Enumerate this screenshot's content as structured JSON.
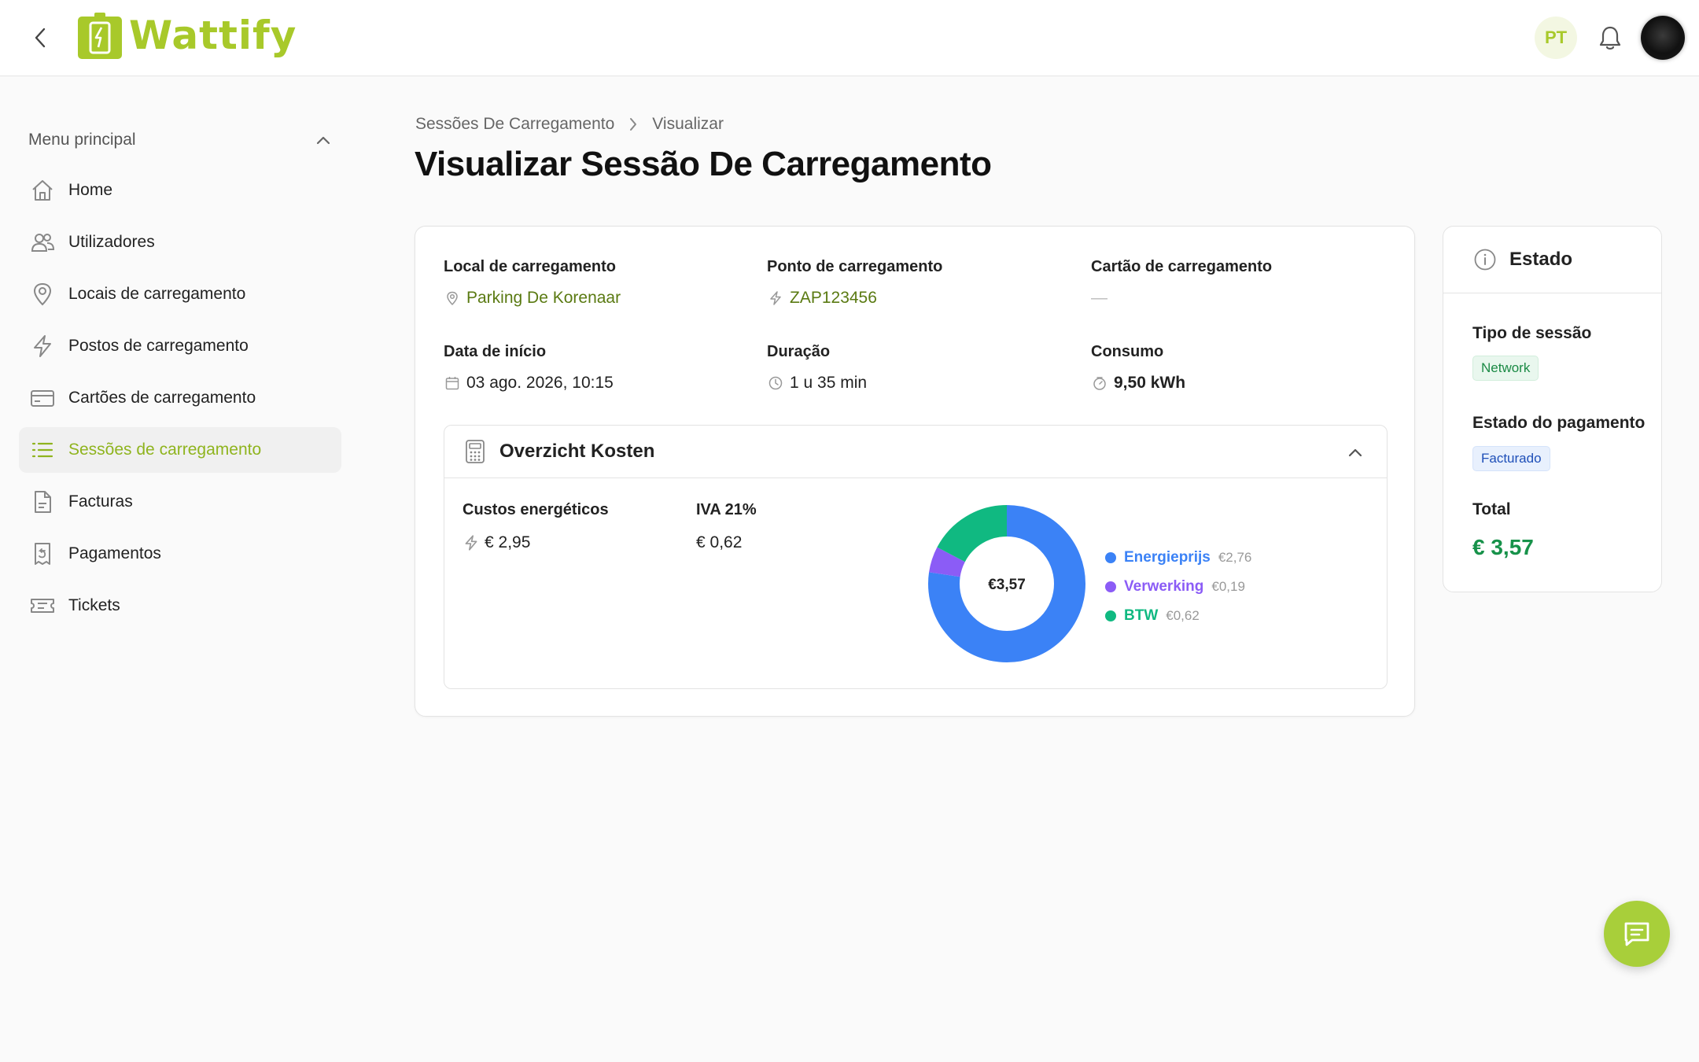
{
  "app": {
    "name": "Wattify",
    "user_initials": "PT"
  },
  "sidebar": {
    "menu_title": "Menu principal",
    "items": [
      {
        "label": "Home",
        "icon": "home-icon"
      },
      {
        "label": "Utilizadores",
        "icon": "users-icon"
      },
      {
        "label": "Locais de carregamento",
        "icon": "map-pin-icon"
      },
      {
        "label": "Postos de carregamento",
        "icon": "bolt-icon"
      },
      {
        "label": "Cartões de carregamento",
        "icon": "card-icon"
      },
      {
        "label": "Sessões de carregamento",
        "icon": "list-icon",
        "active": true
      },
      {
        "label": "Facturas",
        "icon": "document-icon"
      },
      {
        "label": "Pagamentos",
        "icon": "receipt-icon"
      },
      {
        "label": "Tickets",
        "icon": "ticket-icon"
      }
    ]
  },
  "breadcrumb": {
    "parent": "Sessões De Carregamento",
    "current": "Visualizar"
  },
  "page": {
    "title": "Visualizar Sessão De Carregamento"
  },
  "details": {
    "location": {
      "label": "Local de carregamento",
      "value": "Parking De Korenaar"
    },
    "charge_point": {
      "label": "Ponto de carregamento",
      "value": "ZAP123456"
    },
    "charge_card": {
      "label": "Cartão de carregamento",
      "value": "—"
    },
    "start_date": {
      "label": "Data de início",
      "value": "03 ago. 2026, 10:15"
    },
    "duration": {
      "label": "Duração",
      "value": "1 u 35 min"
    },
    "consumption": {
      "label": "Consumo",
      "value": "9,50 kWh"
    }
  },
  "costs": {
    "title": "Overzicht Kosten",
    "energy": {
      "label": "Custos energéticos",
      "value": "€ 2,95"
    },
    "vat": {
      "label": "IVA 21%",
      "value": "€ 0,62"
    },
    "donut_center": "€3,57",
    "breakdown": [
      {
        "name": "Energieprijs",
        "amount": "€2,76",
        "value": 2.76,
        "color": "#3b82f6"
      },
      {
        "name": "Verwerking",
        "amount": "€0,19",
        "value": 0.19,
        "color": "#8b5cf6"
      },
      {
        "name": "BTW",
        "amount": "€0,62",
        "value": 0.62,
        "color": "#10b981"
      }
    ]
  },
  "status": {
    "title": "Estado",
    "session_type": {
      "label": "Tipo de sessão",
      "value": "Network"
    },
    "payment_status": {
      "label": "Estado do pagamento",
      "value": "Facturado"
    },
    "total": {
      "label": "Total",
      "value": "€ 3,57"
    }
  },
  "colors": {
    "brand": "#a8c92a",
    "accent_active": "#8fb41e",
    "total": "#17924a"
  }
}
